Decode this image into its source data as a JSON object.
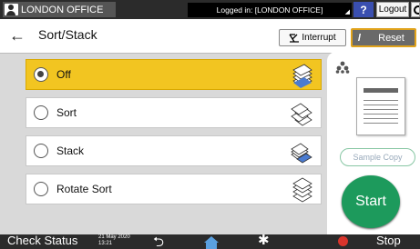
{
  "topbar": {
    "user_label": "LONDON OFFICE",
    "login_status": "Logged in: [LONDON OFFICE]",
    "help_label": "?",
    "logout_label": "Logout"
  },
  "header": {
    "title": "Sort/Stack",
    "interrupt_label": "Interrupt",
    "reset_label": "Reset"
  },
  "options": [
    {
      "label": "Off",
      "selected": true
    },
    {
      "label": "Sort",
      "selected": false
    },
    {
      "label": "Stack",
      "selected": false
    },
    {
      "label": "Rotate Sort",
      "selected": false
    }
  ],
  "side": {
    "sample_copy_label": "Sample Copy",
    "start_label": "Start"
  },
  "bottombar": {
    "check_status_label": "Check Status",
    "date": "21 May 2020",
    "time": "13:21",
    "stop_label": "Stop"
  },
  "colors": {
    "selected": "#f2c521",
    "start": "#1d9a5c",
    "help": "#3a4fb0",
    "reset_border": "#e0a21a",
    "stop": "#d9342b"
  }
}
